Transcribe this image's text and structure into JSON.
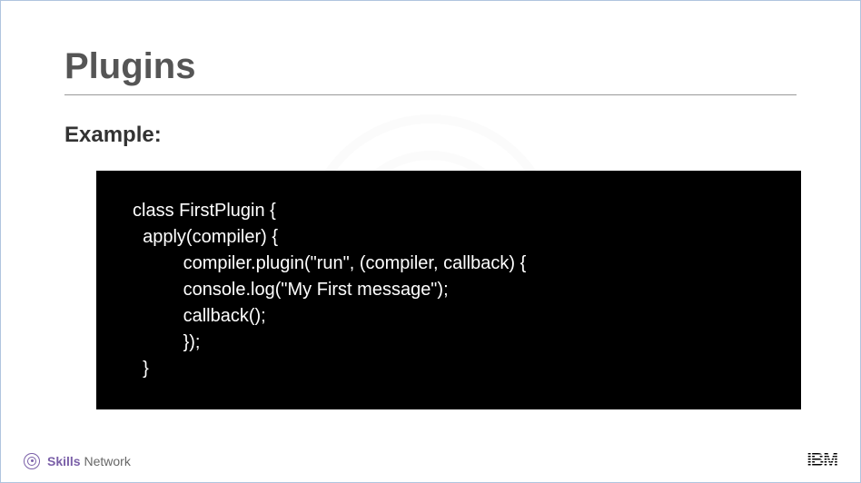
{
  "title": "Plugins",
  "subtitle": "Example:",
  "code": "class FirstPlugin {\n  apply(compiler) {\n          compiler.plugin(\"run\", (compiler, callback) {\n          console.log(\"My First message\");\n          callback();\n          });\n  }",
  "footer": {
    "skills_bold": "Skills",
    "skills_regular": " Network",
    "ibm": "IBM"
  }
}
